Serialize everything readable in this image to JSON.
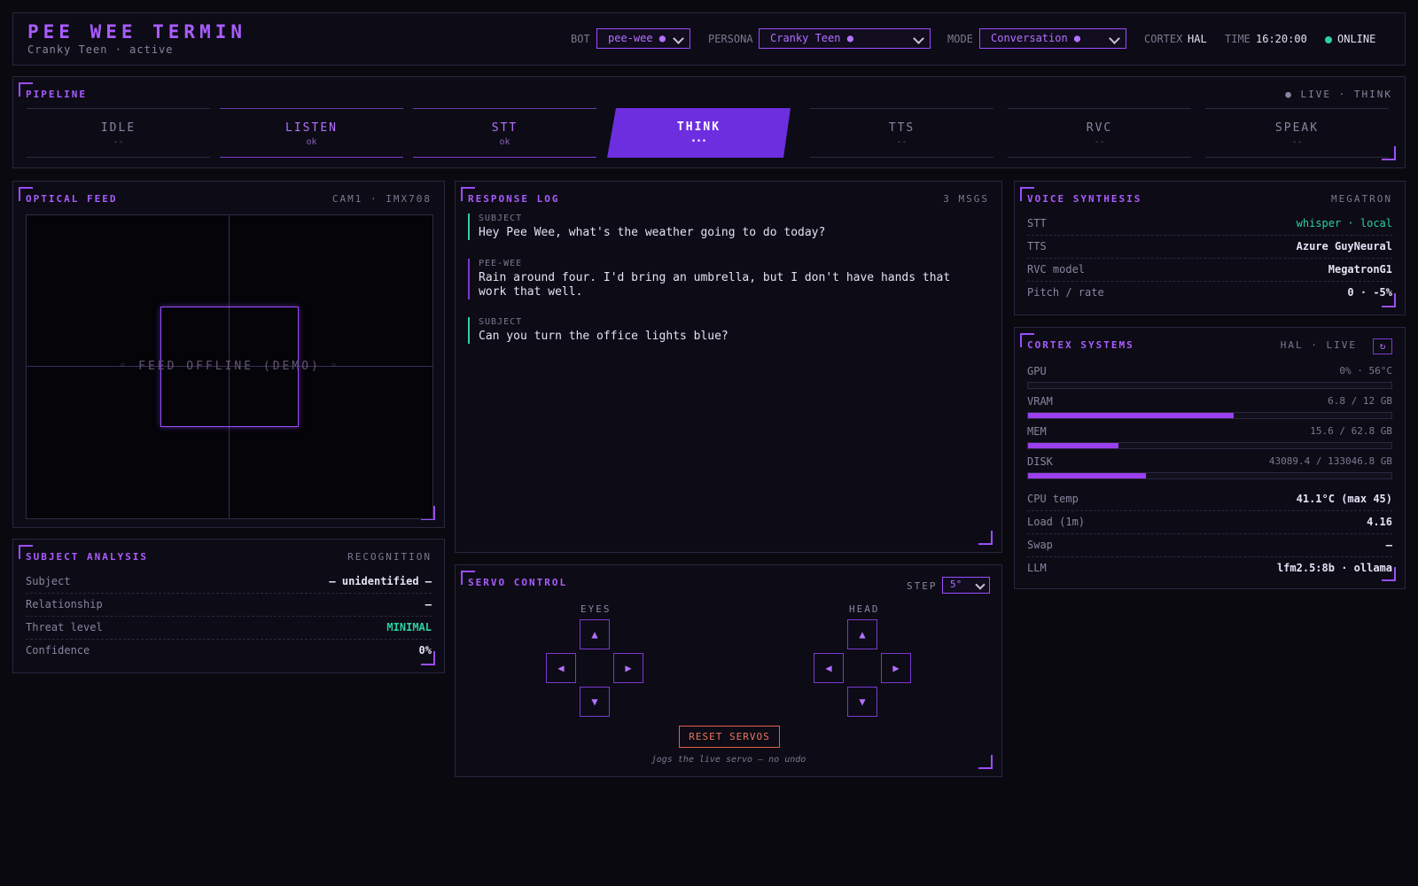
{
  "header": {
    "title": "PEE WEE TERMIN",
    "subtitle": "Cranky Teen · active",
    "bot_label": "BOT",
    "bot_value": "pee-wee ●",
    "persona_label": "PERSONA",
    "persona_value": "Cranky Teen ●",
    "mode_label": "MODE",
    "mode_value": "Conversation ●",
    "cortex_label": "CORTEX",
    "cortex_value": "HAL",
    "time_label": "TIME",
    "time_value": "16:20:00",
    "status": "ONLINE"
  },
  "pipeline": {
    "title": "PIPELINE",
    "meta": "● LIVE · THINK",
    "stages": [
      {
        "name": "IDLE",
        "status": "--"
      },
      {
        "name": "LISTEN",
        "status": "ok"
      },
      {
        "name": "STT",
        "status": "ok"
      },
      {
        "name": "THINK",
        "status": "•••"
      },
      {
        "name": "TTS",
        "status": "--"
      },
      {
        "name": "RVC",
        "status": "--"
      },
      {
        "name": "SPEAK",
        "status": "--"
      }
    ]
  },
  "optical": {
    "title": "OPTICAL FEED",
    "meta": "CAM1 · IMX708",
    "overlay": "◦ FEED OFFLINE (DEMO) ◦"
  },
  "subject": {
    "title": "SUBJECT ANALYSIS",
    "meta": "RECOGNITION",
    "rows": [
      {
        "k": "Subject",
        "v": "— unidentified —"
      },
      {
        "k": "Relationship",
        "v": "—"
      },
      {
        "k": "Threat level",
        "v": "MINIMAL"
      },
      {
        "k": "Confidence",
        "v": "0%"
      }
    ]
  },
  "log": {
    "title": "RESPONSE LOG",
    "meta": "3 MSGS",
    "messages": [
      {
        "who": "SUBJECT",
        "text": "Hey Pee Wee, what's the weather going to do today?"
      },
      {
        "who": "PEE-WEE",
        "text": "Rain around four. I'd bring an umbrella, but I don't have hands that work that well."
      },
      {
        "who": "SUBJECT",
        "text": "Can you turn the office lights blue?"
      }
    ]
  },
  "servo": {
    "title": "SERVO CONTROL",
    "step_label": "STEP",
    "step_value": "5°",
    "eyes_label": "EYES",
    "head_label": "HEAD",
    "up": "▲",
    "down": "▼",
    "left": "◀",
    "right": "▶",
    "reset_label": "RESET SERVOS",
    "note": "jogs the live servo — no undo"
  },
  "voice": {
    "title": "VOICE SYNTHESIS",
    "meta": "MEGATRON",
    "rows": [
      {
        "k": "STT",
        "v": "whisper · local"
      },
      {
        "k": "TTS",
        "v": "Azure GuyNeural"
      },
      {
        "k": "RVC model",
        "v": "MegatronG1"
      },
      {
        "k": "Pitch / rate",
        "v": "0 · -5%"
      }
    ]
  },
  "cortex": {
    "title": "CORTEX SYSTEMS",
    "meta": "HAL · LIVE",
    "refresh": "↻",
    "bars": [
      {
        "k": "GPU",
        "v": "0% · 56°C",
        "fill": 0.0
      },
      {
        "k": "VRAM",
        "v": "6.8 / 12 GB",
        "fill": 0.567
      },
      {
        "k": "MEM",
        "v": "15.6 / 62.8 GB",
        "fill": 0.248
      },
      {
        "k": "DISK",
        "v": "43089.4 / 133046.8 GB",
        "fill": 0.324
      }
    ],
    "rows": [
      {
        "k": "CPU temp",
        "v": "41.1°C (max 45)"
      },
      {
        "k": "Load (1m)",
        "v": "4.16"
      },
      {
        "k": "Swap",
        "v": "—"
      },
      {
        "k": "LLM",
        "v": "lfm2.5:8b · ollama"
      }
    ]
  },
  "colors": {
    "accent": "#9b4dff",
    "accent_active": "#6d2ee0",
    "ok": "#2ad1a3",
    "warn": "#e0604a",
    "background": "#0a0910"
  }
}
